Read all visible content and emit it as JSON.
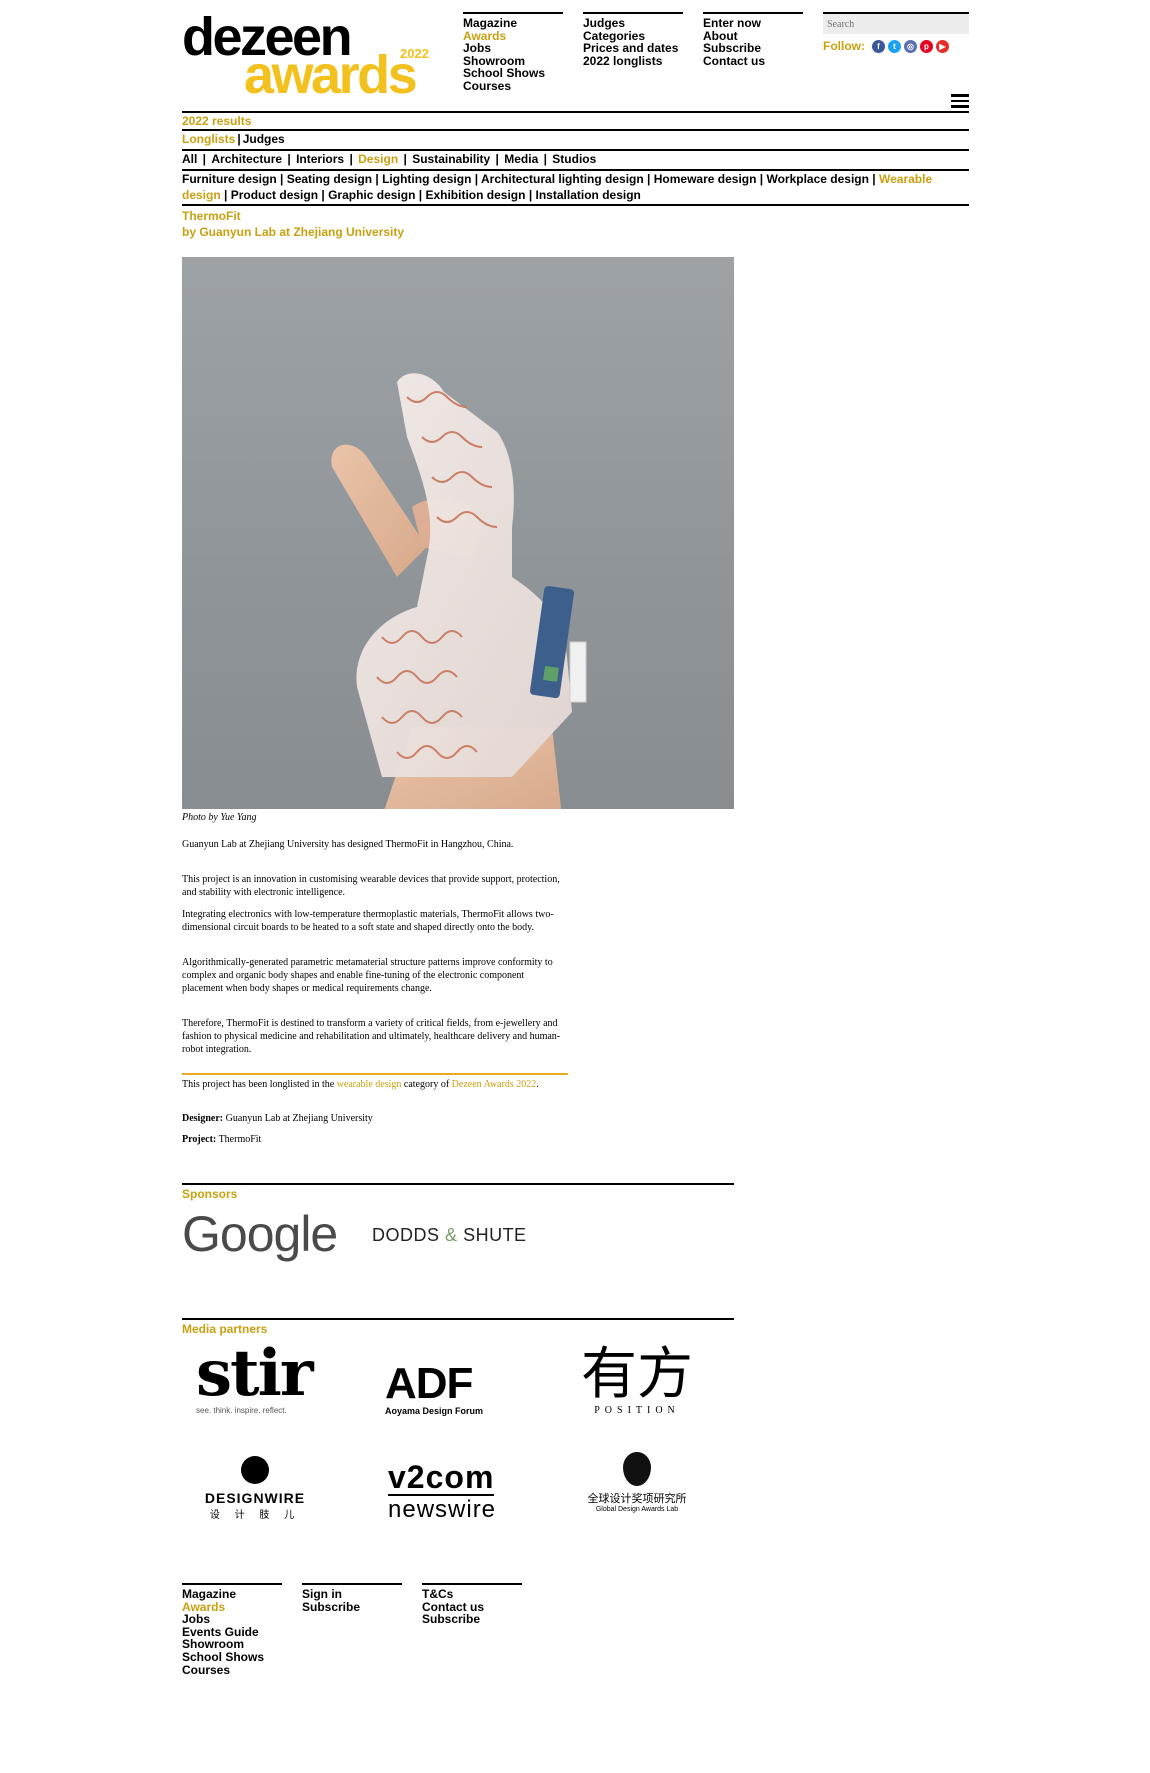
{
  "logo": {
    "line1": "dezeen",
    "line2": "awards",
    "year": "2022"
  },
  "nav": {
    "col1": [
      "Magazine",
      "Awards",
      "Jobs",
      "Showroom",
      "School Shows",
      "Courses"
    ],
    "col2": [
      "Judges",
      "Categories",
      "Prices and dates",
      "2022 longlists"
    ],
    "col3": [
      "Enter now",
      "About",
      "Subscribe",
      "Contact us"
    ]
  },
  "search": {
    "placeholder": "Search"
  },
  "follow": {
    "label": "Follow:",
    "icons": [
      "facebook-icon",
      "twitter-icon",
      "instagram-icon",
      "pinterest-icon",
      "youtube-icon"
    ]
  },
  "subnav": {
    "results": "2022 results",
    "tabs": [
      "Longlists",
      "Judges"
    ],
    "categories": [
      "All",
      "Architecture",
      "Interiors",
      "Design",
      "Sustainability",
      "Media",
      "Studios"
    ],
    "subcategories": [
      "Furniture design",
      "Seating design",
      "Lighting design",
      "Architectural lighting design",
      "Homeware design",
      "Workplace design",
      "Wearable design",
      "Product design",
      "Graphic design",
      "Exhibition design",
      "Installation design"
    ]
  },
  "project": {
    "title": "ThermoFit",
    "byline": "by Guanyun Lab at Zhejiang University",
    "photo_credit": "Photo by Yue Yang",
    "intro": "Guanyun Lab at Zhejiang University has designed ThermoFit in Hangzhou, China.",
    "paragraphs": [
      "This project is an innovation in customising wearable devices that provide support, protection, and stability with electronic intelligence.",
      "Integrating electronics with low-temperature thermoplastic materials, ThermoFit allows two-dimensional circuit boards to be heated to a soft state and shaped directly onto the body.",
      "Algorithmically-generated parametric metamaterial structure patterns improve conformity to complex and organic body shapes and enable fine-tuning of the electronic component placement when body shapes or medical requirements change.",
      "Therefore, ThermoFit is destined to transform a variety of critical fields, from e-jewellery and fashion to physical medicine and rehabilitation and ultimately, healthcare delivery and human-robot integration."
    ],
    "longlist_pre": "This project has been longlisted in the ",
    "longlist_link1": "wearable design",
    "longlist_mid": " category of ",
    "longlist_link2": "Dezeen Awards 2022",
    "longlist_end": ".",
    "designer_label": "Designer:",
    "designer": "Guanyun Lab at Zhejiang University",
    "project_label": "Project:",
    "project_name": "ThermoFit"
  },
  "sponsors": {
    "title": "Sponsors",
    "google": "Google",
    "dodds1": "DODDS",
    "amp": "&",
    "dodds2": "SHUTE"
  },
  "media": {
    "title": "Media partners",
    "stir": "stir",
    "stir_tag": "see. think. inspire. reflect.",
    "adf": "ADF",
    "adf_sub": "Aoyama Design Forum",
    "position_cn": "有方",
    "position_en": "POSITION",
    "designwire": "DESIGNWIRE",
    "designwire_cn": "设 计 肢 儿",
    "v2com": "v2com",
    "newswire": "newswire",
    "gda_cn": "全球设计奖项研究所",
    "gda_en": "Global Design Awards Lab"
  },
  "footer": {
    "col1": [
      "Magazine",
      "Awards",
      "Jobs",
      "Events Guide",
      "Showroom",
      "School Shows",
      "Courses"
    ],
    "col2": [
      "Sign in",
      "Subscribe"
    ],
    "col3": [
      "T&Cs",
      "Contact us",
      "Subscribe"
    ]
  }
}
